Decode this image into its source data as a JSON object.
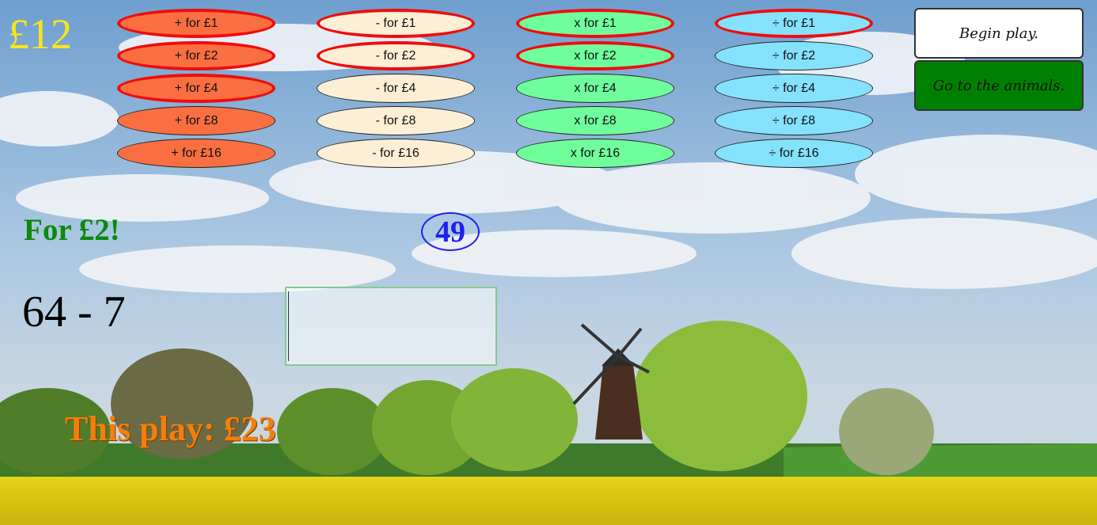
{
  "money": "£12",
  "ops": {
    "plus": [
      {
        "label": "+ for £1",
        "selected": true
      },
      {
        "label": "+ for £2",
        "selected": true
      },
      {
        "label": "+ for £4",
        "selected": true
      },
      {
        "label": "+ for £8",
        "selected": false
      },
      {
        "label": "+ for £16",
        "selected": false
      }
    ],
    "minus": [
      {
        "label": "- for £1",
        "selected": true
      },
      {
        "label": "- for £2",
        "selected": true
      },
      {
        "label": "- for £4",
        "selected": false
      },
      {
        "label": "- for £8",
        "selected": false
      },
      {
        "label": "- for £16",
        "selected": false
      }
    ],
    "times": [
      {
        "label": "x for £1",
        "selected": true
      },
      {
        "label": "x for £2",
        "selected": true
      },
      {
        "label": "x for £4",
        "selected": false
      },
      {
        "label": "x for £8",
        "selected": false
      },
      {
        "label": "x for £16",
        "selected": false
      }
    ],
    "divide": [
      {
        "label": "÷ for £1",
        "selected": true
      },
      {
        "label": "÷ for £2",
        "selected": false
      },
      {
        "label": "÷ for £4",
        "selected": false
      },
      {
        "label": "÷ for £8",
        "selected": false
      },
      {
        "label": "÷ for £16",
        "selected": false
      }
    ]
  },
  "nav": {
    "begin_label": "Begin play.",
    "animals_label": "Go to the animals."
  },
  "round": {
    "for_label": "For £2!",
    "timer": "49",
    "question": "64 - 7",
    "answer_value": ""
  },
  "this_play": "This play: £23",
  "colors": {
    "plus": "#f96f41",
    "minus": "#fdefd6",
    "times": "#70fe9c",
    "divide": "#85e2fd",
    "selected_border": "#f00c0c",
    "animals_button": "#008000"
  },
  "scene_icons": [
    "windmill-icon",
    "tree-icon",
    "cloud-icon"
  ]
}
